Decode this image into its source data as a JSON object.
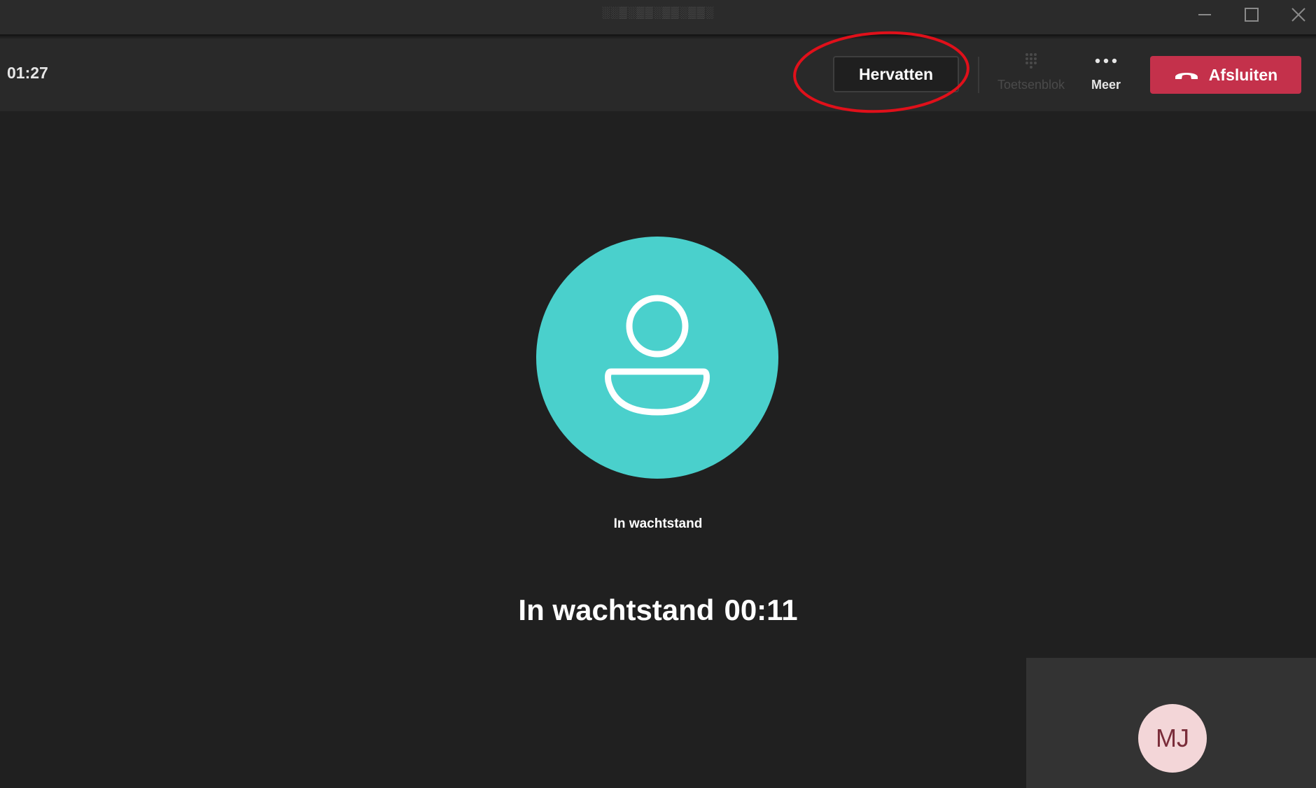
{
  "titlebar": {
    "title": "░░▒░▒▒░▒▒░▒▒░"
  },
  "toolbar": {
    "call_timer": "01:27",
    "resume_label": "Hervatten",
    "keypad_label": "Toetsenblok",
    "more_label": "Meer",
    "hangup_label": "Afsluiten"
  },
  "stage": {
    "avatar_status": "In wachtstand",
    "hold_label": "In wachtstand",
    "hold_timer": "00:11"
  },
  "self_preview": {
    "initials": "MJ"
  },
  "colors": {
    "accent_teal": "#4ad0cc",
    "hangup_red": "#c4314b",
    "highlight_ring": "#e0101a",
    "self_avatar_bg": "#f3d6d8"
  },
  "icons": {
    "keypad": "keypad-icon",
    "more": "more-dots-icon",
    "hangup": "phone-hangup-icon",
    "person": "person-icon"
  }
}
